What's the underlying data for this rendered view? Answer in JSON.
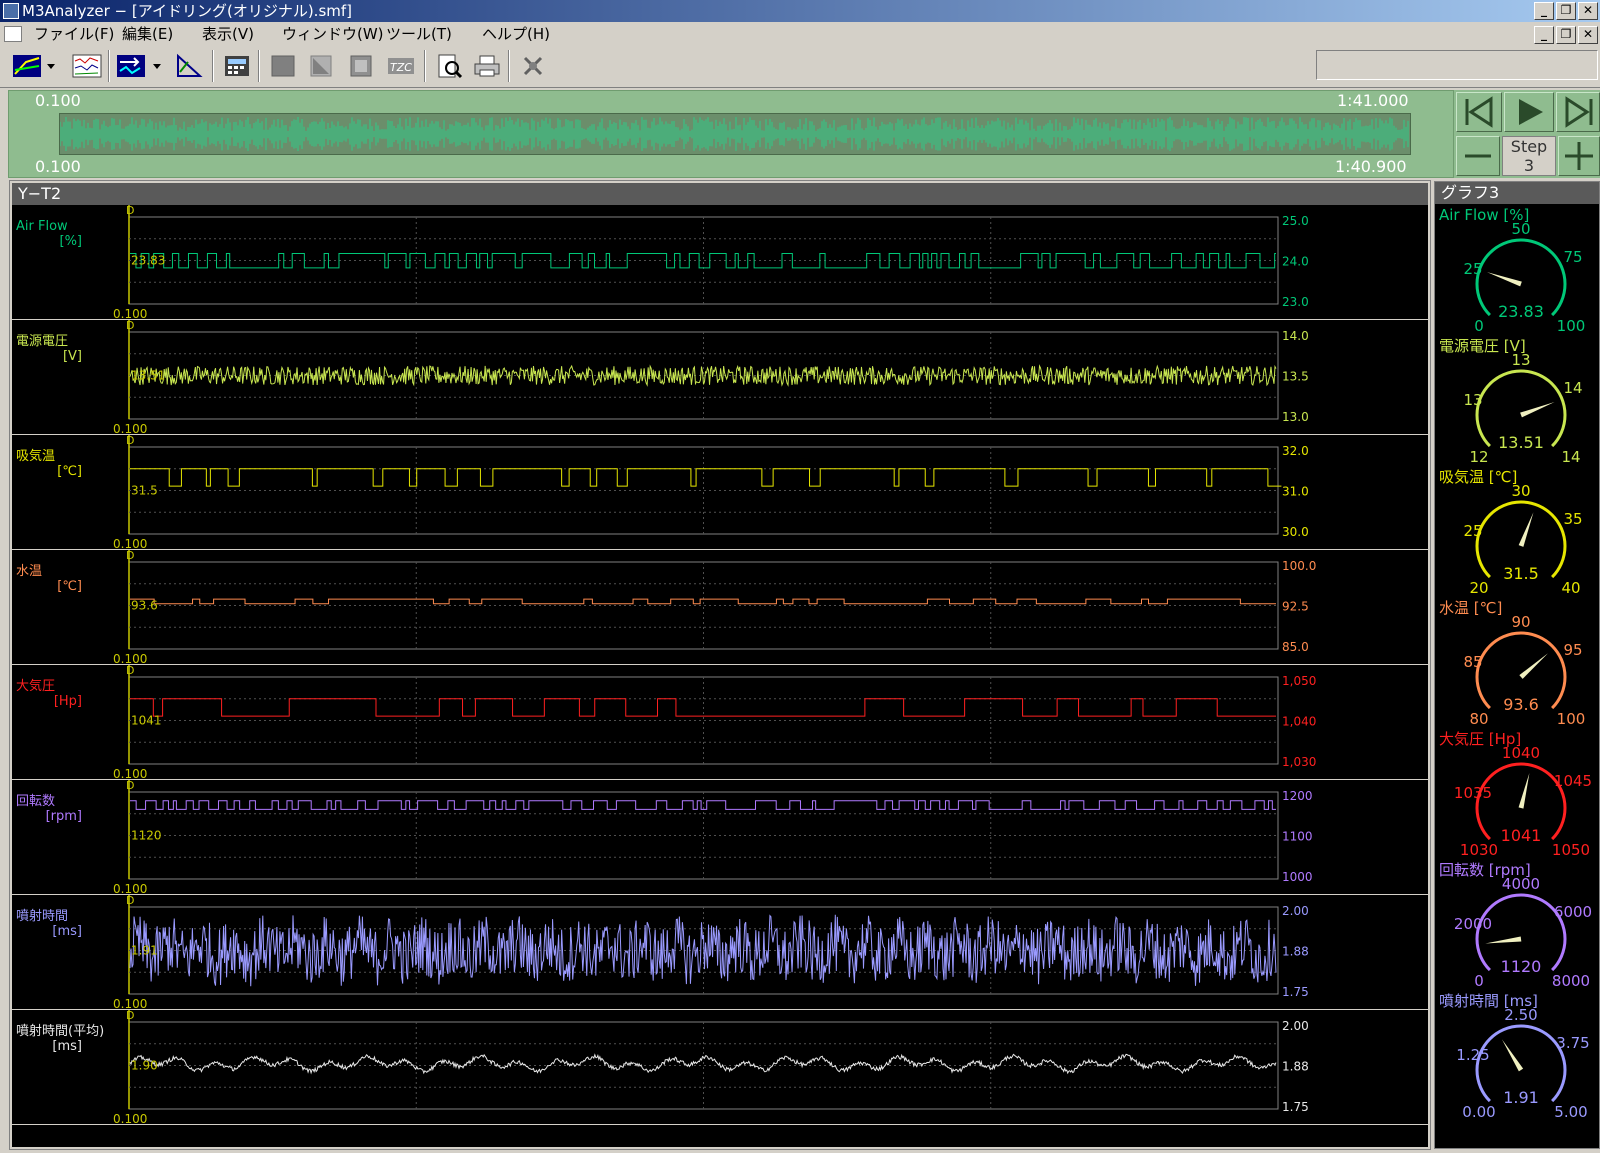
{
  "window": {
    "title": "M3Analyzer − [アイドリング(オリジナル).smf]"
  },
  "menu": [
    "ファイル(F)",
    "編集(E)",
    "表示(V)",
    "ウィンドウ(W)",
    "ツール(T)",
    "ヘルプ(H)"
  ],
  "timeline": {
    "start_top": "0.100",
    "end_top": "1:41.000",
    "start_bottom": "0.100",
    "end_bottom": "1:40.900"
  },
  "play": {
    "step_label": "Step",
    "step_value": "3"
  },
  "yt": {
    "title": "Y−T2"
  },
  "gauges": {
    "title": "グラフ3"
  },
  "channels": [
    {
      "name": "Air Flow",
      "unit": "[%]",
      "color": "#00c878",
      "ticks": [
        "25.0",
        "24.0",
        "23.0"
      ],
      "cursor": "23.83",
      "t0": "0.100",
      "ymin": 23.0,
      "ymax": 25.0,
      "wave": "square",
      "lo": 23.83,
      "hi": 24.16,
      "gauge": {
        "label": "Air Flow [%]",
        "min": "0",
        "max": "100",
        "mid": "50",
        "q1": "25",
        "q3": "75",
        "value": "23.83",
        "frac": 0.2383
      }
    },
    {
      "name": "電源電圧",
      "unit": "[V]",
      "color": "#c8e650",
      "ticks": [
        "14.0",
        "13.5",
        "13.0"
      ],
      "cursor": "13.51",
      "t0": "0.100",
      "ymin": 13.0,
      "ymax": 14.0,
      "wave": "noise",
      "lo": 13.51,
      "hi": 13.51,
      "gauge": {
        "label": "電源電圧 [V]",
        "min": "12",
        "max": "14",
        "mid": "13",
        "q1": "13",
        "q3": "14",
        "value": "13.51",
        "frac": 0.755
      }
    },
    {
      "name": "吸気温",
      "unit": "[℃]",
      "color": "#e6e600",
      "ticks": [
        "32.0",
        "31.0",
        "30.0"
      ],
      "cursor": "31.5",
      "t0": "0.100",
      "ymin": 30.0,
      "ymax": 32.0,
      "wave": "dips",
      "lo": 31.1,
      "hi": 31.5,
      "gauge": {
        "label": "吸気温 [℃]",
        "min": "20",
        "max": "40",
        "mid": "30",
        "q1": "25",
        "q3": "35",
        "value": "31.5",
        "frac": 0.575
      }
    },
    {
      "name": "水温",
      "unit": "[℃]",
      "color": "#ff8c50",
      "ticks": [
        "100.0",
        "92.5",
        "85.0"
      ],
      "cursor": "93.6",
      "t0": "0.100",
      "ymin": 85.0,
      "ymax": 100.0,
      "wave": "square2",
      "lo": 92.8,
      "hi": 93.6,
      "gauge": {
        "label": "水温 [℃]",
        "min": "80",
        "max": "100",
        "mid": "90",
        "q1": "85",
        "q3": "95",
        "value": "93.6",
        "frac": 0.68
      }
    },
    {
      "name": "大気圧",
      "unit": "[Hp]",
      "color": "#ff2020",
      "ticks": [
        "1,050",
        "1,040",
        "1,030"
      ],
      "cursor": "1041",
      "t0": "0.100",
      "ymin": 1030,
      "ymax": 1050,
      "wave": "square3",
      "lo": 1041,
      "hi": 1045,
      "gauge": {
        "label": "大気圧 [Hp]",
        "min": "1030",
        "max": "1050",
        "mid": "1040",
        "q1": "1035",
        "q3": "1045",
        "value": "1041",
        "frac": 0.55
      }
    },
    {
      "name": "回転数",
      "unit": "[rpm]",
      "color": "#b07aff",
      "ticks": [
        "1200",
        "1100",
        "1000"
      ],
      "cursor": "1120",
      "t0": "0.100",
      "ymin": 1000,
      "ymax": 1200,
      "wave": "square",
      "lo": 1160,
      "hi": 1180,
      "gauge": {
        "label": "回転数 [rpm]",
        "min": "0",
        "max": "8000",
        "mid": "4000",
        "q1": "2000",
        "q3": "6000",
        "value": "1120",
        "frac": 0.14
      }
    },
    {
      "name": "噴射時間",
      "unit": "[ms]",
      "color": "#9a9aff",
      "ticks": [
        "2.00",
        "1.88",
        "1.75"
      ],
      "cursor": "1.91",
      "t0": "0.100",
      "ymin": 1.75,
      "ymax": 2.0,
      "wave": "noise2",
      "lo": 1.875,
      "hi": 1.875,
      "gauge": {
        "label": "噴射時間 [ms]",
        "min": "0.00",
        "max": "5.00",
        "mid": "2.50",
        "q1": "1.25",
        "q3": "3.75",
        "value": "1.91",
        "frac": 0.382
      }
    },
    {
      "name": "噴射時間(平均)",
      "unit": "[ms]",
      "color": "#e8e8e8",
      "ticks": [
        "2.00",
        "1.88",
        "1.75"
      ],
      "cursor": "1.90",
      "t0": "0.100",
      "ymin": 1.75,
      "ymax": 2.0,
      "wave": "smooth",
      "lo": 1.88,
      "hi": 1.88,
      "gauge": null
    }
  ],
  "colors": {
    "timeline_bg": "#8fbc8f",
    "plot_bg": "#000000",
    "axis": "#c8c800",
    "grid": "#404040"
  }
}
